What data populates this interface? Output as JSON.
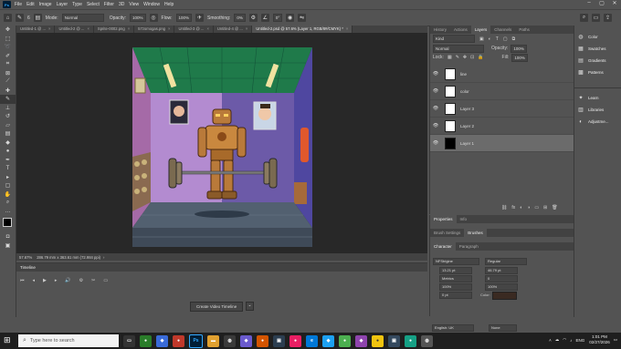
{
  "menubar": {
    "items": [
      "File",
      "Edit",
      "Image",
      "Layer",
      "Type",
      "Select",
      "Filter",
      "3D",
      "View",
      "Window",
      "Help"
    ],
    "logo": "Ps",
    "win_controls": [
      "–",
      "▢",
      "✕"
    ]
  },
  "options": {
    "mode_label": "Mode:",
    "mode_value": "Normal",
    "opacity_label": "Opacity:",
    "opacity_value": "100%",
    "flow_label": "Flow:",
    "flow_value": "100%",
    "smoothing_label": "Smoothing:",
    "smoothing_value": "0%",
    "angle_value": "0°",
    "brush_size": "6"
  },
  "tabs": [
    {
      "label": "Untitled-1 @ ...",
      "active": false
    },
    {
      "label": "Untitled-2 @ ...",
      "active": false
    },
    {
      "label": "Sprite-0002.png",
      "active": false
    },
    {
      "label": "57zomogas.png",
      "active": false
    },
    {
      "label": "Untitled-3 @ ...",
      "active": false
    },
    {
      "label": "Untitled-4 @ ...",
      "active": false
    },
    {
      "label": "Untitled-2.psd @ 57.6% (Layer 1, RGB/8#/CMYK) *",
      "active": true
    }
  ],
  "status": {
    "zoom": "57.67%",
    "size": "286.79 mm x 363.61 mm (72.984 ppi)"
  },
  "timeline": {
    "title": "Timeline",
    "create_button": "Create Video Timeline",
    "dropdown": "⌄",
    "controls": [
      "⏮",
      "◂",
      "▶",
      "▸",
      "🔊",
      "⚙",
      "✂",
      "▭"
    ]
  },
  "layers_panel": {
    "tabs": [
      "History",
      "Actions",
      "Layers",
      "Channels",
      "Paths"
    ],
    "active_tab": "Layers",
    "filter_kind": "Kind",
    "blend_mode": "Normal",
    "opacity_label": "Opacity:",
    "opacity_value": "100%",
    "lock_label": "Lock:",
    "fill_label": "Fill:",
    "fill_value": "100%",
    "layers": [
      {
        "name": "line",
        "selected": false,
        "thumb": "#ffffff"
      },
      {
        "name": "color",
        "selected": false,
        "thumb": "#ffffff"
      },
      {
        "name": "Layer 3",
        "selected": false,
        "thumb": "#ffffff"
      },
      {
        "name": "Layer 2",
        "selected": false,
        "thumb": "#ffffff"
      },
      {
        "name": "Layer 1",
        "selected": true,
        "thumb": "#000000"
      }
    ],
    "footer_icons": [
      "⛓",
      "fx",
      "◐",
      "◑",
      "▭",
      "⊞",
      "🗑"
    ]
  },
  "properties": {
    "tabs": [
      "Properties",
      "Info"
    ],
    "sub_tabs": [
      "Brush Settings",
      "Brushes"
    ],
    "char_tabs": [
      "Character",
      "Paragraph"
    ],
    "font_family": "NFStrigine",
    "font_style": "Regular",
    "font_size": "13.21 pt",
    "leading": "46.79 pt",
    "kerning": "Metrics",
    "tracking": "0",
    "vscale": "100%",
    "hscale": "100%",
    "baseline": "0 pt",
    "color_label": "Color:",
    "language": "English: UK",
    "aa": "Sharp",
    "aa_value": "None"
  },
  "dock": {
    "group1": [
      "Color",
      "Swatches",
      "Gradients",
      "Patterns"
    ],
    "group2": [
      "Learn",
      "Libraries",
      "Adjustme..."
    ]
  },
  "taskbar": {
    "search_placeholder": "Type here to search",
    "time": "1:01 PM",
    "date": "02/27/2026",
    "lang": "ENG"
  },
  "colors": {
    "app_bg": "#535353",
    "canvas_bg": "#282828",
    "accent": "#31a8ff"
  }
}
